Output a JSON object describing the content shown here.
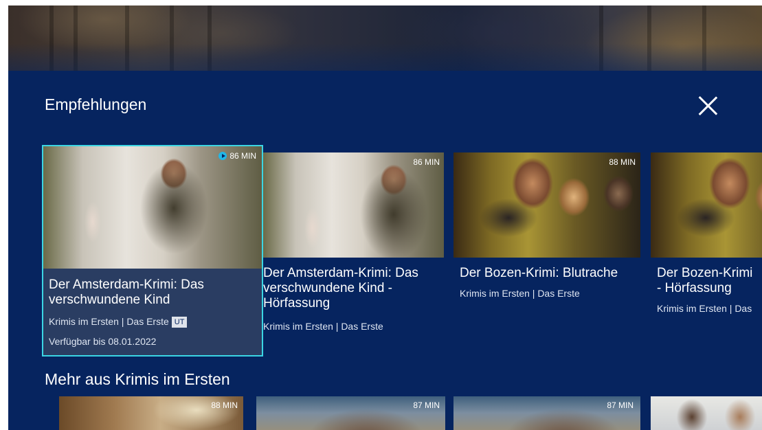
{
  "panel": {
    "title": "Empfehlungen",
    "close_icon": "close-icon"
  },
  "recommendations": [
    {
      "title": "Der Amsterdam-Krimi: Das\nverschwundene Kind",
      "duration": "86 MIN",
      "meta": "Krimis im Ersten | Das Erste",
      "badge": "UT",
      "availability": "Verfügbar bis 08.01.2022",
      "focused": true,
      "play_icon": "play-circle-icon"
    },
    {
      "title": "Der Amsterdam-Krimi: Das\nverschwundene Kind -\nHörfassung",
      "duration": "86 MIN",
      "meta": "Krimis im Ersten | Das Erste"
    },
    {
      "title": "Der Bozen-Krimi: Blutrache",
      "duration": "88 MIN",
      "meta": "Krimis im Ersten | Das Erste"
    },
    {
      "title": "Der Bozen-Krimi\n- Hörfassung",
      "duration": "",
      "meta": "Krimis im Ersten | Das"
    }
  ],
  "more_section": {
    "title": "Mehr aus Krimis im Ersten",
    "durations": [
      "88 MIN",
      "87 MIN",
      "87 MIN"
    ]
  },
  "colors": {
    "background": "#06245f",
    "focus_border": "#3bd6e4",
    "focused_card": "#2a3d62",
    "play_accent": "#21b7e8"
  }
}
